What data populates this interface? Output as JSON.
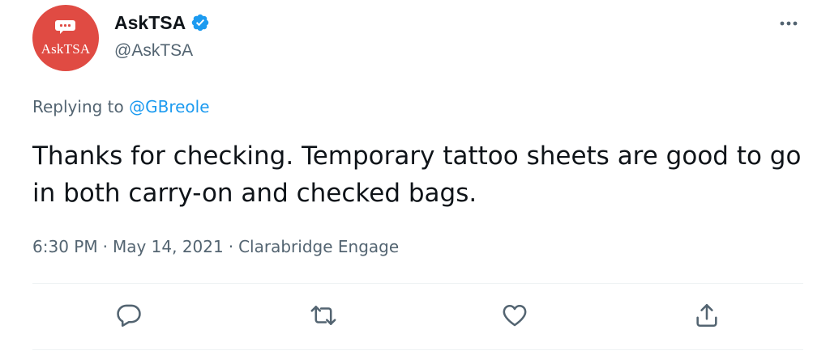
{
  "author": {
    "display_name": "AskTSA",
    "handle": "@AskTSA",
    "avatar_text": "AskTSA",
    "verified": true,
    "avatar_color": "#e04b43"
  },
  "reply": {
    "prefix": "Replying to",
    "to": "@GBreole"
  },
  "tweet": {
    "text": "Thanks for checking. Temporary tattoo sheets are good to go in both carry-on and checked bags."
  },
  "meta": {
    "time": "6:30 PM",
    "separator": "·",
    "date": "May 14, 2021",
    "source": "Clarabridge Engage"
  },
  "icons": {
    "verified": "verified-badge-icon",
    "more": "more-options-icon",
    "reply": "reply-icon",
    "retweet": "retweet-icon",
    "like": "like-icon",
    "share": "share-icon"
  },
  "colors": {
    "link": "#1d9bf0",
    "muted": "#536471",
    "text": "#0f1419",
    "verified": "#1d9bf0"
  }
}
